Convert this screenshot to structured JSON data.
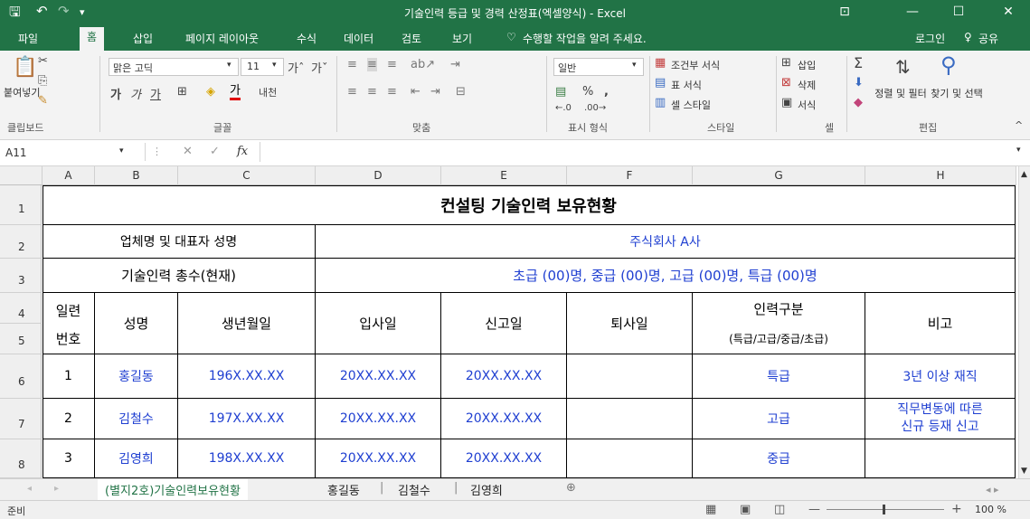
{
  "window": {
    "title": "기술인력 등급 및 경력 산정표(엑셀양식) - Excel",
    "save_icon": "save-icon",
    "undo_icon": "undo-icon"
  },
  "ribbon_tabs": [
    "파일",
    "홈",
    "삽입",
    "페이지 레이아웃",
    "수식",
    "데이터",
    "검토",
    "보기"
  ],
  "tell_me": "수행할 작업을 알려 주세요.",
  "account": {
    "login": "로그인",
    "share": "공유"
  },
  "ribbon": {
    "paste": "붙여넣기",
    "clipboard": "클립보드",
    "font_name": "맑은 고딕",
    "font_size": "11",
    "font_group": "글꼴",
    "bold": "가",
    "italic": "가",
    "underline": "가",
    "font_color": "가",
    "align_group": "맞춤",
    "number_format": "일반",
    "percent": "%",
    "comma": ",",
    "number_group": "표시 형식",
    "cond_format": "조건부 서식",
    "table_format": "표 서식",
    "cell_style": "셀 스타일",
    "style_group": "스타일",
    "insert": "삽입",
    "delete": "삭제",
    "format": "서식",
    "cells_group": "셀",
    "sort_filter": "정렬 및 필터",
    "find_select": "찾기 및 선택",
    "edit_group": "편집",
    "accent": "#217346"
  },
  "formula_bar": {
    "name_box": "A11",
    "fx": "fx",
    "value": ""
  },
  "columns": [
    "A",
    "B",
    "C",
    "D",
    "E",
    "F",
    "G",
    "H"
  ],
  "rows": [
    "1",
    "2",
    "3",
    "4",
    "5",
    "6",
    "7",
    "8"
  ],
  "sheet": {
    "title": "컨설팅 기술인력 보유현황",
    "company_label": "업체명 및 대표자 성명",
    "company_value": "주식회사 A사",
    "staff_label": "기술인력 총수(현재)",
    "staff_value": "초급 (00)명, 중급 (00)명, 고급 (00)명, 특급 (00)명",
    "headers": {
      "no_line1": "일련",
      "no_line2": "번호",
      "name": "성명",
      "birth": "생년월일",
      "join": "입사일",
      "report": "신고일",
      "leave": "퇴사일",
      "grade": "인력구분",
      "grade_sub": "(특급/고급/중급/초급)",
      "note": "비고"
    },
    "entries": [
      {
        "no": "1",
        "name": "홍길동",
        "birth": "196X.XX.XX",
        "join": "20XX.XX.XX",
        "report": "20XX.XX.XX",
        "leave": "",
        "grade": "특급",
        "note1": "3년 이상 재직",
        "note2": ""
      },
      {
        "no": "2",
        "name": "김철수",
        "birth": "197X.XX.XX",
        "join": "20XX.XX.XX",
        "report": "20XX.XX.XX",
        "leave": "",
        "grade": "고급",
        "note1": "직무변동에 따른",
        "note2": "신규 등재 신고"
      },
      {
        "no": "3",
        "name": "김영희",
        "birth": "198X.XX.XX",
        "join": "20XX.XX.XX",
        "report": "20XX.XX.XX",
        "leave": "",
        "grade": "중급",
        "note1": "",
        "note2": ""
      }
    ]
  },
  "sheet_tabs": [
    "(별지2호)기술인력보유현황",
    "홍길동",
    "김철수",
    "김영희"
  ],
  "status": {
    "ready": "준비",
    "zoom": "100 %"
  }
}
